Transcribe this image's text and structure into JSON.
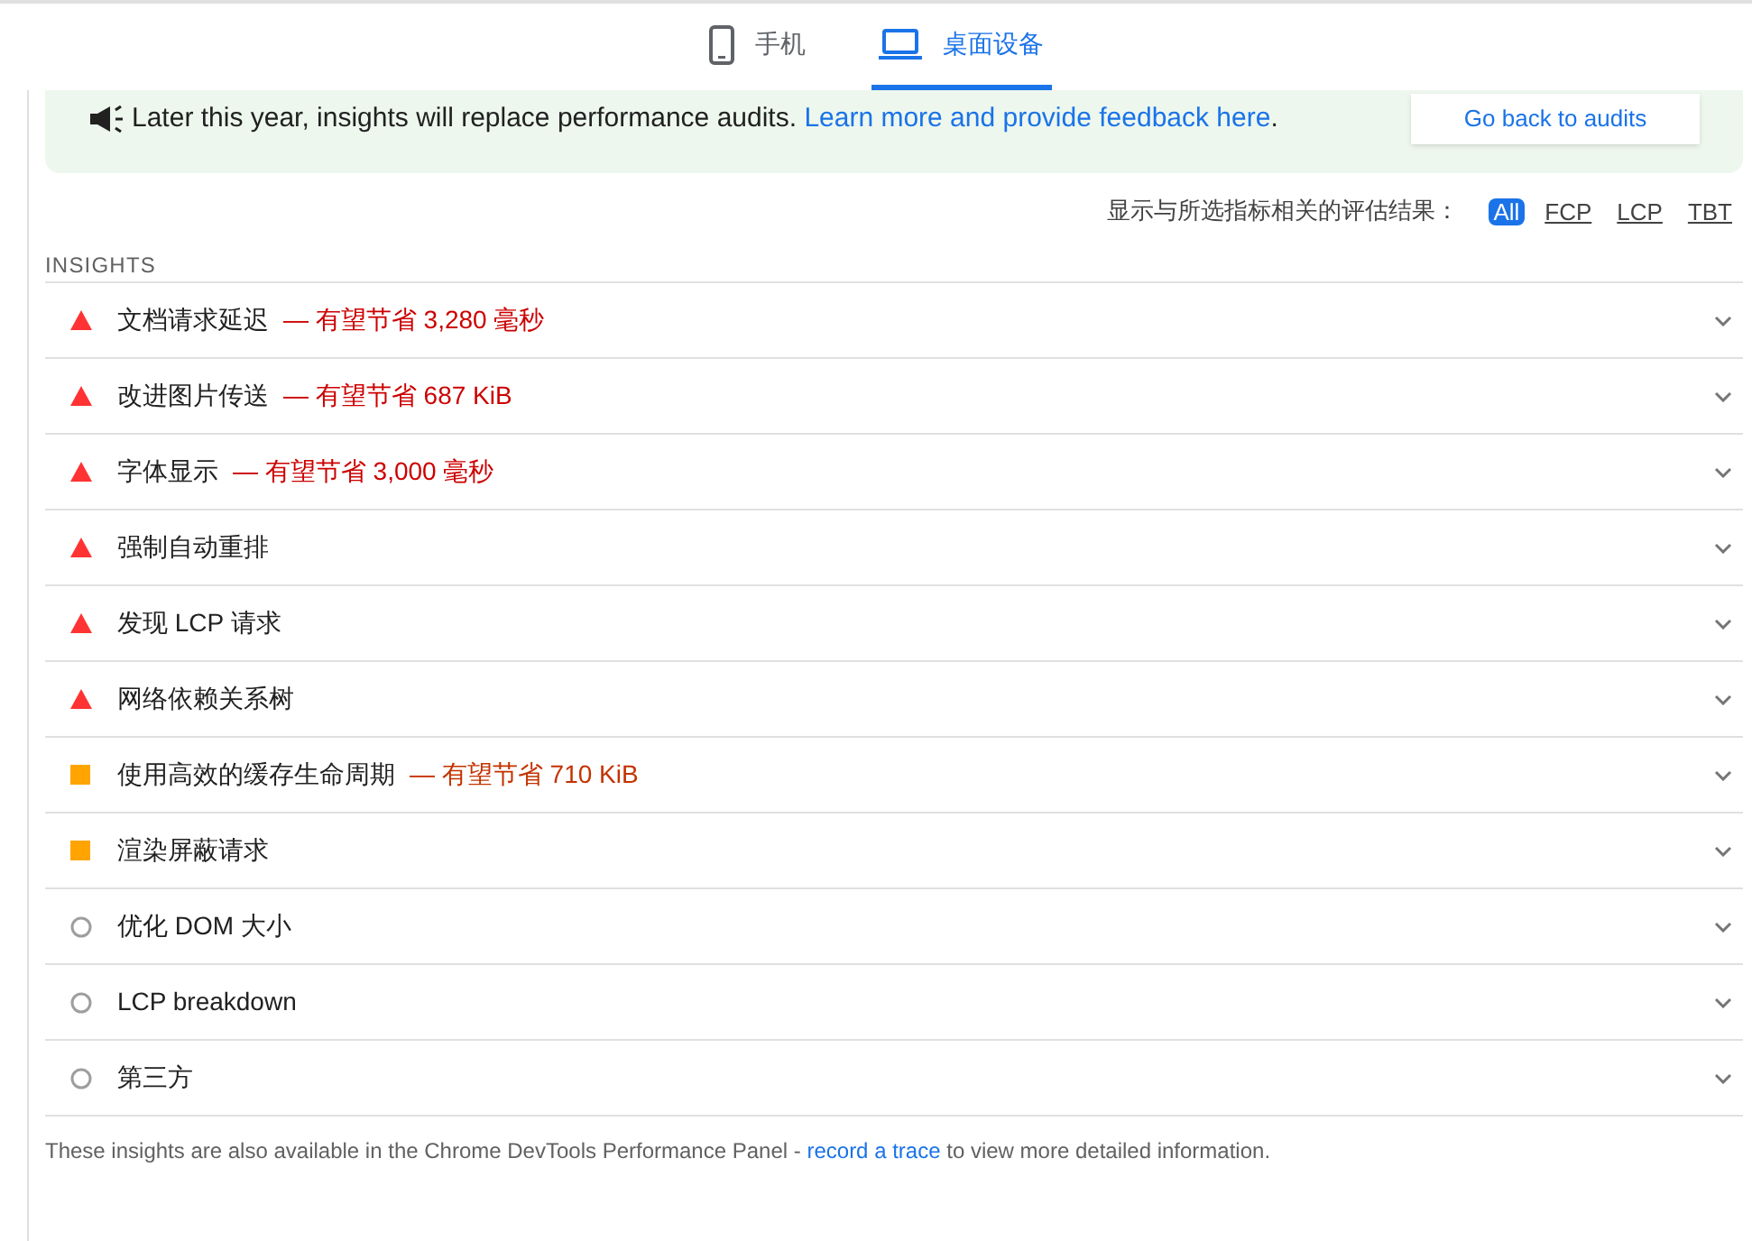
{
  "tabs": [
    {
      "label": "手机",
      "kind": "mobile",
      "selected": false
    },
    {
      "label": "桌面设备",
      "kind": "desktop",
      "selected": true
    }
  ],
  "banner": {
    "text": "Later this year, insights will replace performance audits.",
    "link": "Learn more and provide feedback here",
    "after": ".",
    "button": "Go back to audits"
  },
  "filter": {
    "label": "显示与所选指标相关的评估结果：",
    "options": [
      {
        "label": "All",
        "selected": true
      },
      {
        "label": "FCP",
        "selected": false
      },
      {
        "label": "LCP",
        "selected": false
      },
      {
        "label": "TBT",
        "selected": false
      }
    ]
  },
  "section_title": "INSIGHTS",
  "insights": [
    {
      "title": "文档请求延迟",
      "kind": "fail",
      "savings": "— 有望节省 3,280 毫秒"
    },
    {
      "title": "改进图片传送",
      "kind": "fail",
      "savings": "— 有望节省 687 KiB"
    },
    {
      "title": "字体显示",
      "kind": "fail",
      "savings": "— 有望节省 3,000 毫秒"
    },
    {
      "title": "强制自动重排",
      "kind": "fail"
    },
    {
      "title": "发现 LCP 请求",
      "kind": "fail"
    },
    {
      "title": "网络依赖关系树",
      "kind": "fail"
    },
    {
      "title": "使用高效的缓存生命周期",
      "kind": "average",
      "savings": "— 有望节省 710 KiB"
    },
    {
      "title": "渲染屏蔽请求",
      "kind": "average"
    },
    {
      "title": "优化 DOM 大小",
      "kind": "info"
    },
    {
      "title": "LCP breakdown",
      "kind": "info"
    },
    {
      "title": "第三方",
      "kind": "info"
    }
  ],
  "footer": {
    "before": "These insights are also available in the Chrome DevTools Performance Panel -",
    "link": "record a trace",
    "after": "to view more detailed information."
  }
}
